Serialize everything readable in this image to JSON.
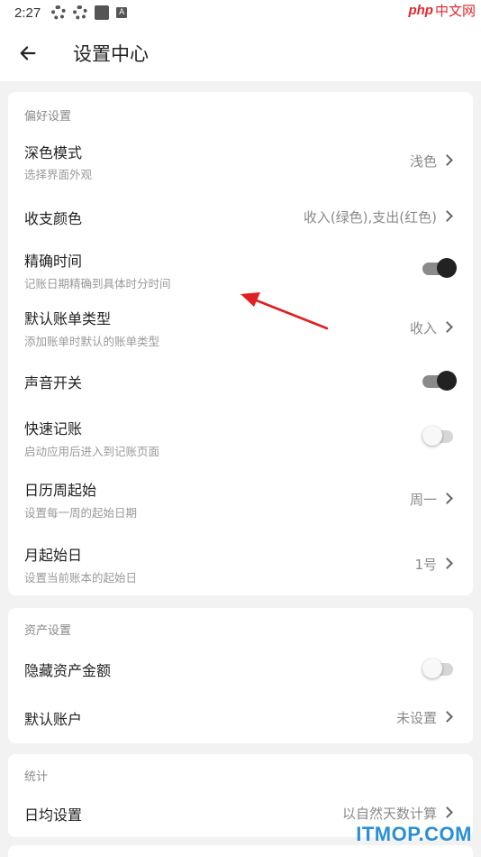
{
  "status_bar": {
    "time": "2:27",
    "icons": [
      "gear-icon",
      "gear-icon",
      "square-icon",
      "a-icon"
    ]
  },
  "watermark_top": {
    "brand": "php",
    "suffix": "中文网"
  },
  "header": {
    "title": "设置中心",
    "back_icon": "arrow-left-icon"
  },
  "sections": {
    "preferences": {
      "title": "偏好设置",
      "dark_mode": {
        "title": "深色模式",
        "subtitle": "选择界面外观",
        "value": "浅色"
      },
      "color": {
        "title": "收支颜色",
        "value": "收入(绿色),支出(红色)"
      },
      "precise_time": {
        "title": "精确时间",
        "subtitle": "记账日期精确到具体时分时间",
        "enabled": true
      },
      "default_type": {
        "title": "默认账单类型",
        "subtitle": "添加账单时默认的账单类型",
        "value": "收入"
      },
      "sound": {
        "title": "声音开关",
        "enabled": true
      },
      "quick_entry": {
        "title": "快速记账",
        "subtitle": "启动应用后进入到记账页面",
        "enabled": false
      },
      "week_start": {
        "title": "日历周起始",
        "subtitle": "设置每一周的起始日期",
        "value": "周一"
      },
      "month_start": {
        "title": "月起始日",
        "subtitle": "设置当前账本的起始日",
        "value": "1号"
      }
    },
    "assets": {
      "title": "资产设置",
      "hide_amount": {
        "title": "隐藏资产金额",
        "enabled": false
      },
      "default_account": {
        "title": "默认账户",
        "value": "未设置"
      }
    },
    "stats": {
      "title": "统计",
      "daily_avg": {
        "title": "日均设置",
        "value": "以自然天数计算"
      }
    }
  },
  "watermark_bottom": "ITMOP.COM",
  "colors": {
    "accent_switch_on": "#222222",
    "annotation_arrow": "#e02020",
    "watermark_blue": "#2a8fd6"
  }
}
